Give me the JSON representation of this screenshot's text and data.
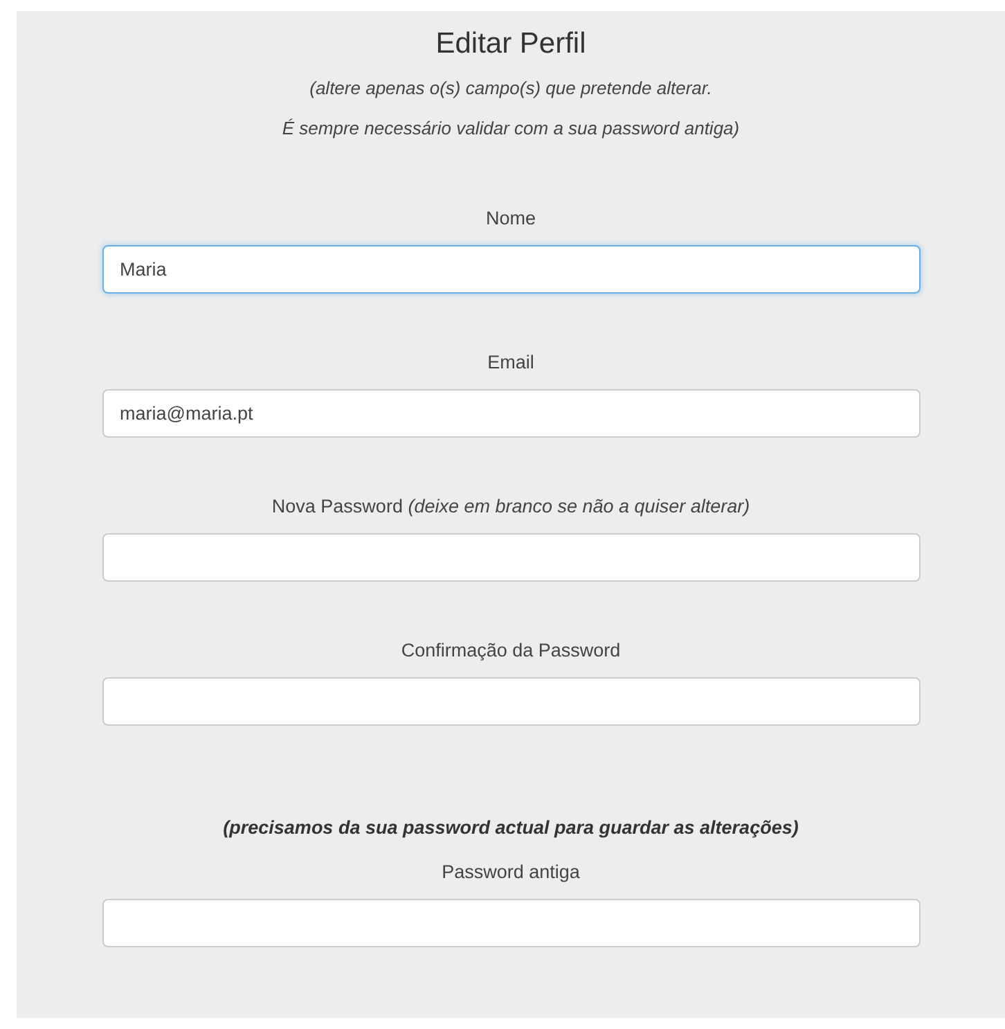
{
  "title": "Editar Perfil",
  "intro": [
    "(altere apenas o(s) campo(s) que pretende alterar.",
    "É sempre necessário validar com a sua password antiga)"
  ],
  "fields": [
    {
      "label": "Nome",
      "value": "Maria",
      "focused": true
    },
    {
      "label": "Email",
      "value": "maria@maria.pt",
      "focused": false
    },
    {
      "label": "Nova Password *(deixe em branco se não a quiser alterar)*",
      "focused": false
    },
    {
      "label": "Confirmação da Password",
      "focused": false
    },
    {
      "note": "(precisamos da sua password actual para guardar as alterações)",
      "label": "Password antiga",
      "focused": false
    }
  ]
}
